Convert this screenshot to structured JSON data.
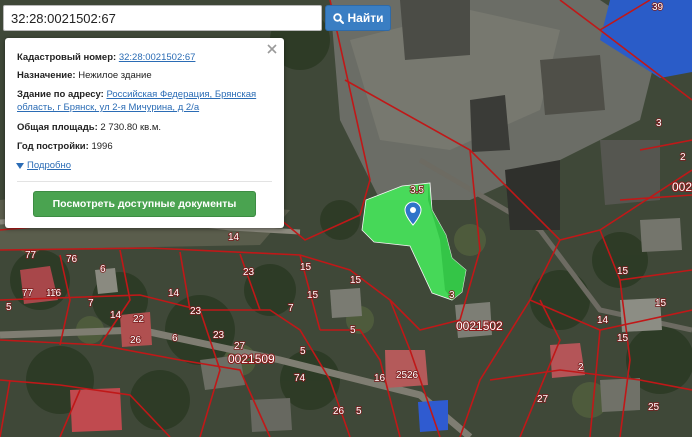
{
  "search": {
    "value": "32:28:0021502:67",
    "button_label": "Найти"
  },
  "popup": {
    "cadastral_label": "Кадастровый номер:",
    "cadastral_value": "32:28:0021502:67",
    "purpose_label": "Назначение:",
    "purpose_value": "Нежилое здание",
    "address_label": "Здание по адресу:",
    "address_value": "Российская Федерация, Брянская область, г Брянск, ул 2-я Мичурина, д 2/а",
    "area_label": "Общая площадь:",
    "area_value": "2 730.80 кв.м.",
    "year_label": "Год постройки:",
    "year_value": "1996",
    "more_label": "Подробно",
    "documents_button": "Посмотреть доступные документы"
  },
  "map": {
    "quarter_labels": [
      "0021502",
      "0021509",
      "002"
    ],
    "parcel_labels": [
      "39",
      "3",
      "2",
      "14",
      "23",
      "14",
      "15",
      "16",
      "77",
      "76",
      "6",
      "7",
      "77",
      "16",
      "5",
      "14",
      "23",
      "5",
      "15",
      "22",
      "26",
      "6",
      "23",
      "7",
      "15",
      "5",
      "27",
      "15",
      "15",
      "15",
      "14",
      "2",
      "16",
      "26",
      "74",
      "26",
      "5",
      "3",
      "27",
      "25",
      "25"
    ],
    "building_label": "3.5",
    "selected_color": "#47e05a",
    "border_color": "#c01818"
  }
}
